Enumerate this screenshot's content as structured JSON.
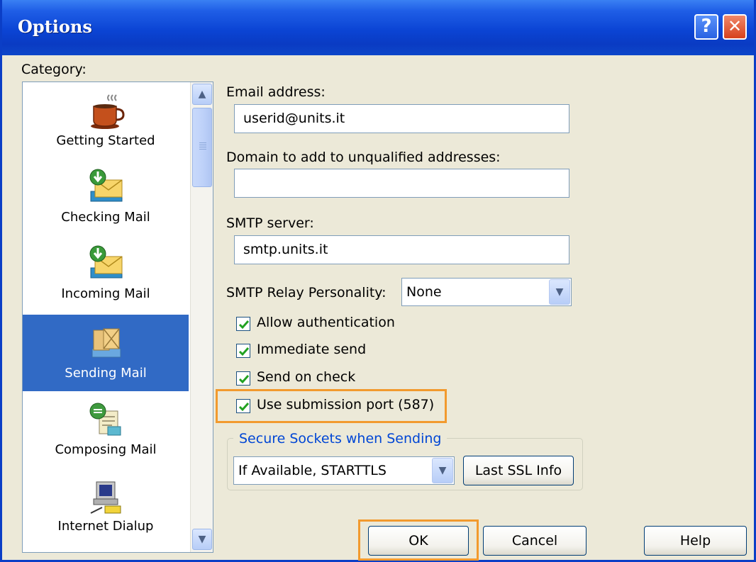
{
  "window": {
    "title": "Options",
    "help_glyph": "?",
    "close_glyph": "✕"
  },
  "sidebar": {
    "label": "Category:",
    "selected": "Sending Mail",
    "items": [
      {
        "label": "Getting Started",
        "icon": "coffee-cup-icon"
      },
      {
        "label": "Checking Mail",
        "icon": "download-mail-icon"
      },
      {
        "label": "Incoming Mail",
        "icon": "incoming-mail-icon"
      },
      {
        "label": "Sending Mail",
        "icon": "sending-mail-icon"
      },
      {
        "label": "Composing Mail",
        "icon": "compose-mail-icon"
      },
      {
        "label": "Internet Dialup",
        "icon": "dialup-computer-icon"
      }
    ]
  },
  "form": {
    "email_label": "Email address:",
    "email_value": "userid@units.it",
    "domain_label": "Domain to add to unqualified addresses:",
    "domain_value": "",
    "smtp_label": "SMTP server:",
    "smtp_value": "smtp.units.it",
    "relay_label": "SMTP Relay Personality:",
    "relay_value": "None",
    "checkboxes": [
      {
        "label": "Allow authentication",
        "checked": true
      },
      {
        "label": "Immediate send",
        "checked": true
      },
      {
        "label": "Send on check",
        "checked": true
      },
      {
        "label": "Use submission port (587)",
        "checked": true
      }
    ],
    "ssl_group_title": "Secure Sockets when Sending",
    "ssl_value": "If Available, STARTTLS",
    "ssl_info_button": "Last SSL Info"
  },
  "buttons": {
    "ok": "OK",
    "cancel": "Cancel",
    "help": "Help"
  },
  "colors": {
    "titlebar": "#0b44d4",
    "selection": "#316ac5",
    "highlight_box": "#f29a2e",
    "checkmark": "#21a121"
  }
}
